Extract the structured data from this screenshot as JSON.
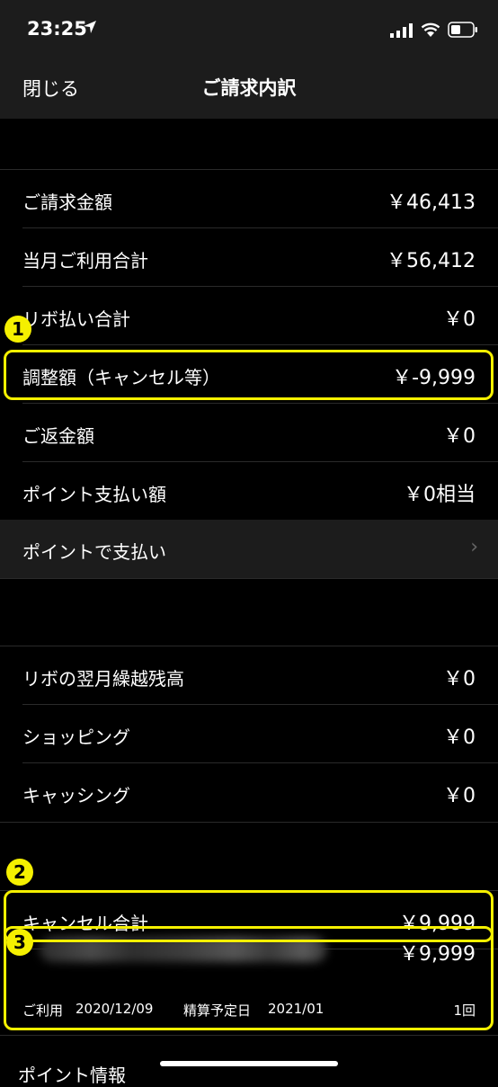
{
  "status": {
    "time": "23:25"
  },
  "nav": {
    "close_label": "閉じる",
    "title": "ご請求内訳"
  },
  "summary": [
    {
      "label": "ご請求金額",
      "value": "￥46,413"
    },
    {
      "label": "当月ご利用合計",
      "value": "￥56,412"
    },
    {
      "label": "リボ払い合計",
      "value": "￥0"
    },
    {
      "label": "調整額（キャンセル等）",
      "value": "￥-9,999"
    },
    {
      "label": "ご返金額",
      "value": "￥0"
    },
    {
      "label": "ポイント支払い額",
      "value": "￥0相当"
    }
  ],
  "point_pay": {
    "label": "ポイントで支払い"
  },
  "revo": [
    {
      "label": "リボの翌月繰越残高",
      "value": "￥0"
    },
    {
      "label": "ショッピング",
      "value": "￥0"
    },
    {
      "label": "キャッシング",
      "value": "￥0"
    }
  ],
  "cancel": {
    "label": "キャンセル合計",
    "total": "￥9,999",
    "item_amount": "￥9,999",
    "use_label": "ご利用",
    "use_date": "2020/12/09",
    "settle_label": "精算予定日",
    "settle_date": "2021/01",
    "count": "1回"
  },
  "annotations": [
    "1",
    "2",
    "3"
  ],
  "footer": {
    "point_info": "ポイント情報"
  },
  "colors": {
    "highlight": "#f5f000",
    "background": "#000000",
    "bar": "#1c1c1c"
  }
}
